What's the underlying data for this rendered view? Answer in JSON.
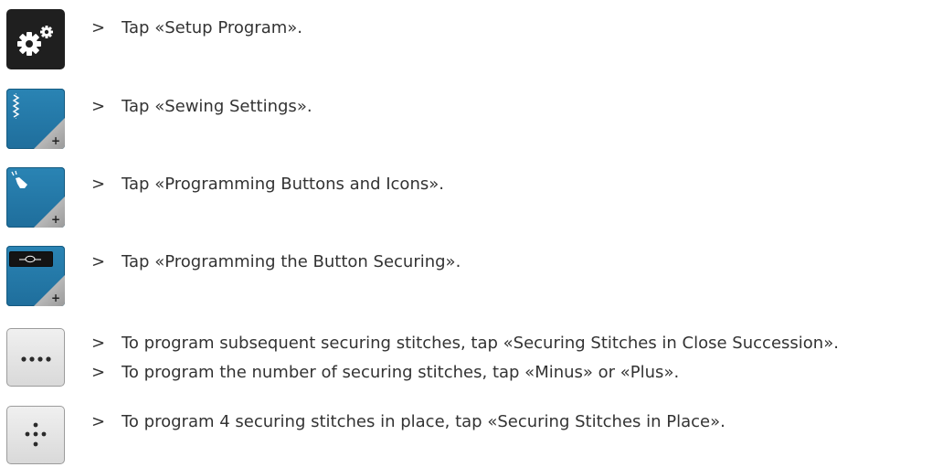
{
  "icons": {
    "setup": "gear-icon",
    "sewing": "stitch-icon",
    "programming": "hand-pointer-icon",
    "securing_button": "securing-knot-icon",
    "succession": "four-dots-icon",
    "in_place": "dots-cluster-icon"
  },
  "colors": {
    "icon_blue": "#2378a8",
    "icon_dark": "#1f1f1f",
    "icon_grey": "#e2e2e2"
  },
  "steps": [
    {
      "marker": ">",
      "text": "Tap «Setup Program»."
    },
    {
      "marker": ">",
      "text": "Tap «Sewing Settings»."
    },
    {
      "marker": ">",
      "text": "Tap «Programming Buttons and Icons»."
    },
    {
      "marker": ">",
      "text": "Tap «Programming the Button Securing»."
    },
    {
      "marker": ">",
      "text": "To program subsequent securing stitches, tap «Securing Stitches in Close Succession»."
    },
    {
      "marker": ">",
      "text": "To program the number of securing stitches, tap «Minus» or «Plus»."
    },
    {
      "marker": ">",
      "text": "To program 4 securing stitches in place, tap «Securing Stitches in Place»."
    }
  ]
}
